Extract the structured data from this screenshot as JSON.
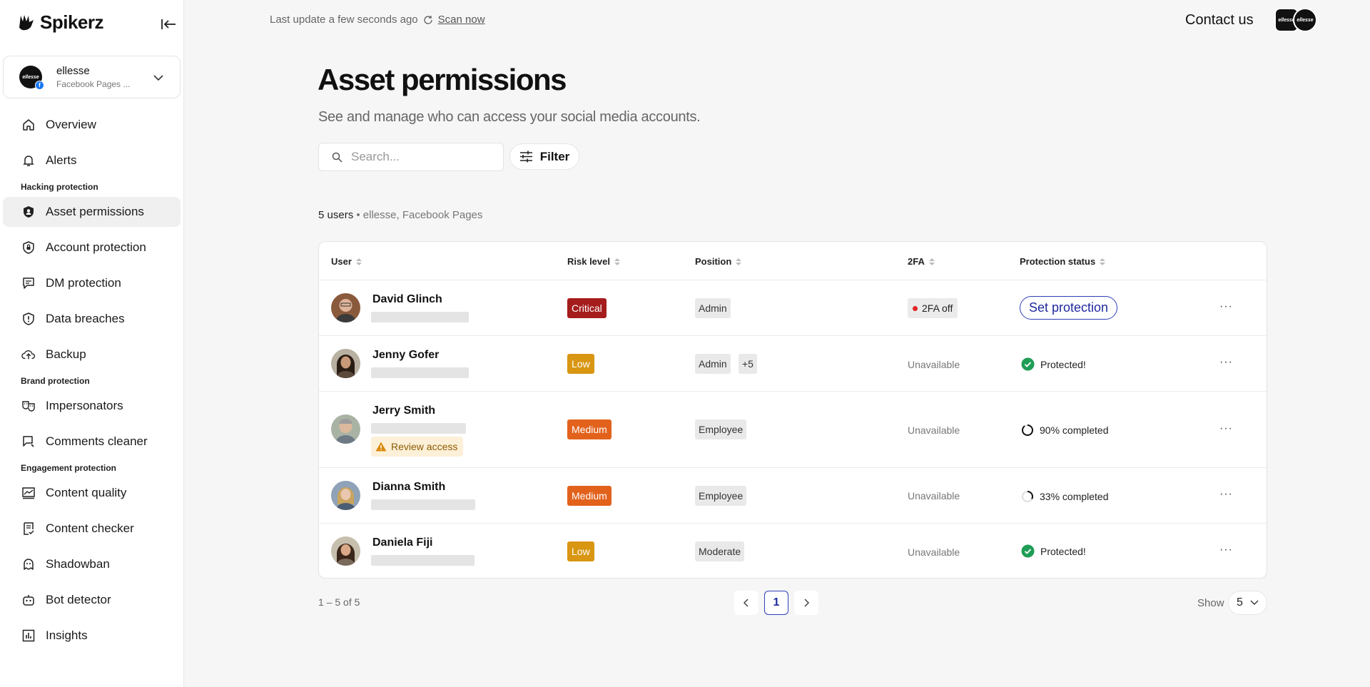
{
  "brand": {
    "name": "Spikerz"
  },
  "account": {
    "avatar_text": "ellesse",
    "name": "ellesse",
    "subtitle": "Facebook Pages ..."
  },
  "nav": {
    "overview": "Overview",
    "alerts": "Alerts",
    "section_hacking": "Hacking protection",
    "asset_permissions": "Asset permissions",
    "account_protection": "Account protection",
    "dm_protection": "DM protection",
    "data_breaches": "Data breaches",
    "backup": "Backup",
    "section_brand": "Brand protection",
    "impersonators": "Impersonators",
    "comments_cleaner": "Comments cleaner",
    "section_engagement": "Engagement protection",
    "content_quality": "Content quality",
    "content_checker": "Content checker",
    "shadowban": "Shadowban",
    "bot_detector": "Bot detector",
    "insights": "Insights"
  },
  "topbar": {
    "last_update": "Last update a few seconds ago",
    "scan_now": "Scan now",
    "contact": "Contact us",
    "avatar_text": "ellesse"
  },
  "page": {
    "title": "Asset permissions",
    "subtitle": "See and manage who can access your social media accounts."
  },
  "search": {
    "placeholder": "Search..."
  },
  "filter": {
    "label": "Filter"
  },
  "summary": {
    "count": "5 users",
    "sep": " • ",
    "context": "ellesse, Facebook Pages"
  },
  "table": {
    "headers": {
      "user": "User",
      "risk": "Risk level",
      "position": "Position",
      "tfa": "2FA",
      "status": "Protection status"
    },
    "rows": [
      {
        "name": "David Glinch",
        "risk": "Critical",
        "position": "Admin",
        "tfa": "2FA off",
        "status": "Set protection",
        "more": "···"
      },
      {
        "name": "Jenny Gofer",
        "risk": "Low",
        "position": "Admin",
        "position_extra": "+5",
        "tfa": "Unavailable",
        "status": "Protected!",
        "more": "···"
      },
      {
        "name": "Jerry Smith",
        "risk": "Medium",
        "position": "Employee",
        "tfa": "Unavailable",
        "review": "Review access",
        "status": "90% completed",
        "status_progress": 0.9,
        "more": "···"
      },
      {
        "name": "Dianna Smith",
        "risk": "Medium",
        "position": "Employee",
        "tfa": "Unavailable",
        "status": "33% completed",
        "status_progress": 0.33,
        "more": "···"
      },
      {
        "name": "Daniela Fiji",
        "risk": "Low",
        "position": "Moderate",
        "tfa": "Unavailable",
        "status": "Protected!",
        "more": "···"
      }
    ]
  },
  "pagination": {
    "range": "1 – 5 of 5",
    "current": "1",
    "show_label": "Show",
    "show_value": "5"
  },
  "colors": {
    "critical": "#a51c1c",
    "low": "#d89612",
    "medium": "#e2621c",
    "accent": "#2f3fb8",
    "success": "#1f9d55"
  }
}
